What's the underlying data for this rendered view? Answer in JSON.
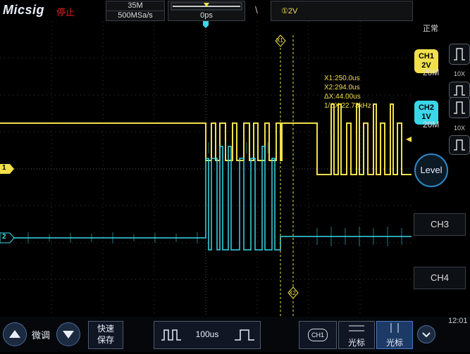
{
  "header": {
    "brand": "Micsig",
    "run_state": "停止",
    "memory_depth": "35M",
    "sample_rate": "500MSa/s",
    "time_position": "0ps",
    "trigger_source_level": "①2V",
    "trigger_edge_icon": "edge-slope-icon"
  },
  "cursor_readout": {
    "x1": "X1:250.0us",
    "x2": "X2:294.0us",
    "dx": "ΔX:44.00us",
    "inv_dx": "1/ΔX:22.73kHz",
    "x1_label": "X1",
    "x2_label": "X2"
  },
  "channels": {
    "ch1_marker": "1",
    "ch2_marker": "2",
    "ch1_color": "#f1e04a",
    "ch2_color": "#39d8e8"
  },
  "side_panel": {
    "acquisition_mode": "正常",
    "ch1": {
      "name": "CH1",
      "scale": "2V",
      "bandwidth": "20M",
      "probe": "10X"
    },
    "ch2": {
      "name": "CH2",
      "scale": "1V",
      "bandwidth": "20M",
      "probe": "10X"
    },
    "level_label": "Level",
    "ch3_label": "CH3",
    "ch4_label": "CH4",
    "clock": "12:01"
  },
  "bottom_bar": {
    "fine_adjust_label": "微调",
    "quick_save_line1": "快速",
    "quick_save_line2": "保存",
    "timebase_value": "100us",
    "ch1_badge": "CH1",
    "cursor_h_label": "光标",
    "cursor_v_label": "光标"
  }
}
